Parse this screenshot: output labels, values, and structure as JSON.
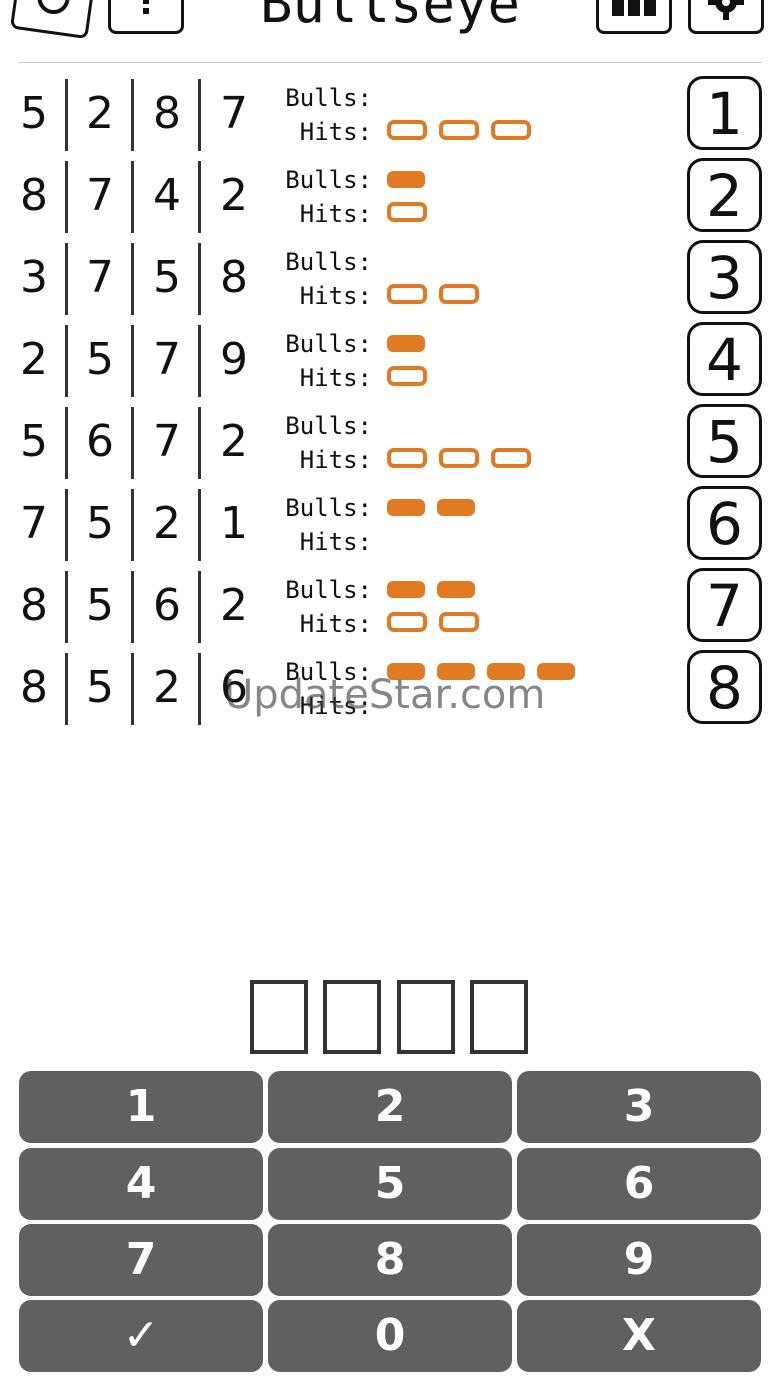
{
  "app": {
    "title": "Bullseye"
  },
  "labels": {
    "bulls": "Bulls:",
    "hits": "Hits:"
  },
  "colors": {
    "peg": "#e07b24",
    "keypad": "#606060"
  },
  "icons": {
    "left": [
      "restart-icon",
      "help-icon"
    ],
    "right": [
      "stats-icon",
      "settings-icon"
    ]
  },
  "guesses": [
    {
      "n": "1",
      "digits": [
        "5",
        "2",
        "8",
        "7"
      ],
      "bulls": 0,
      "hits": 3
    },
    {
      "n": "2",
      "digits": [
        "8",
        "7",
        "4",
        "2"
      ],
      "bulls": 1,
      "hits": 1
    },
    {
      "n": "3",
      "digits": [
        "3",
        "7",
        "5",
        "8"
      ],
      "bulls": 0,
      "hits": 2
    },
    {
      "n": "4",
      "digits": [
        "2",
        "5",
        "7",
        "9"
      ],
      "bulls": 1,
      "hits": 1
    },
    {
      "n": "5",
      "digits": [
        "5",
        "6",
        "7",
        "2"
      ],
      "bulls": 0,
      "hits": 3
    },
    {
      "n": "6",
      "digits": [
        "7",
        "5",
        "2",
        "1"
      ],
      "bulls": 2,
      "hits": 0
    },
    {
      "n": "7",
      "digits": [
        "8",
        "5",
        "6",
        "2"
      ],
      "bulls": 2,
      "hits": 2
    },
    {
      "n": "8",
      "digits": [
        "8",
        "5",
        "2",
        "6"
      ],
      "bulls": 4,
      "hits": 0
    }
  ],
  "input": {
    "slots": [
      "",
      "",
      "",
      ""
    ]
  },
  "keypad": {
    "rows": [
      [
        "1",
        "2",
        "3"
      ],
      [
        "4",
        "5",
        "6"
      ],
      [
        "7",
        "8",
        "9"
      ],
      [
        "✓",
        "0",
        "X"
      ]
    ]
  },
  "watermark": "UpdateStar.com"
}
